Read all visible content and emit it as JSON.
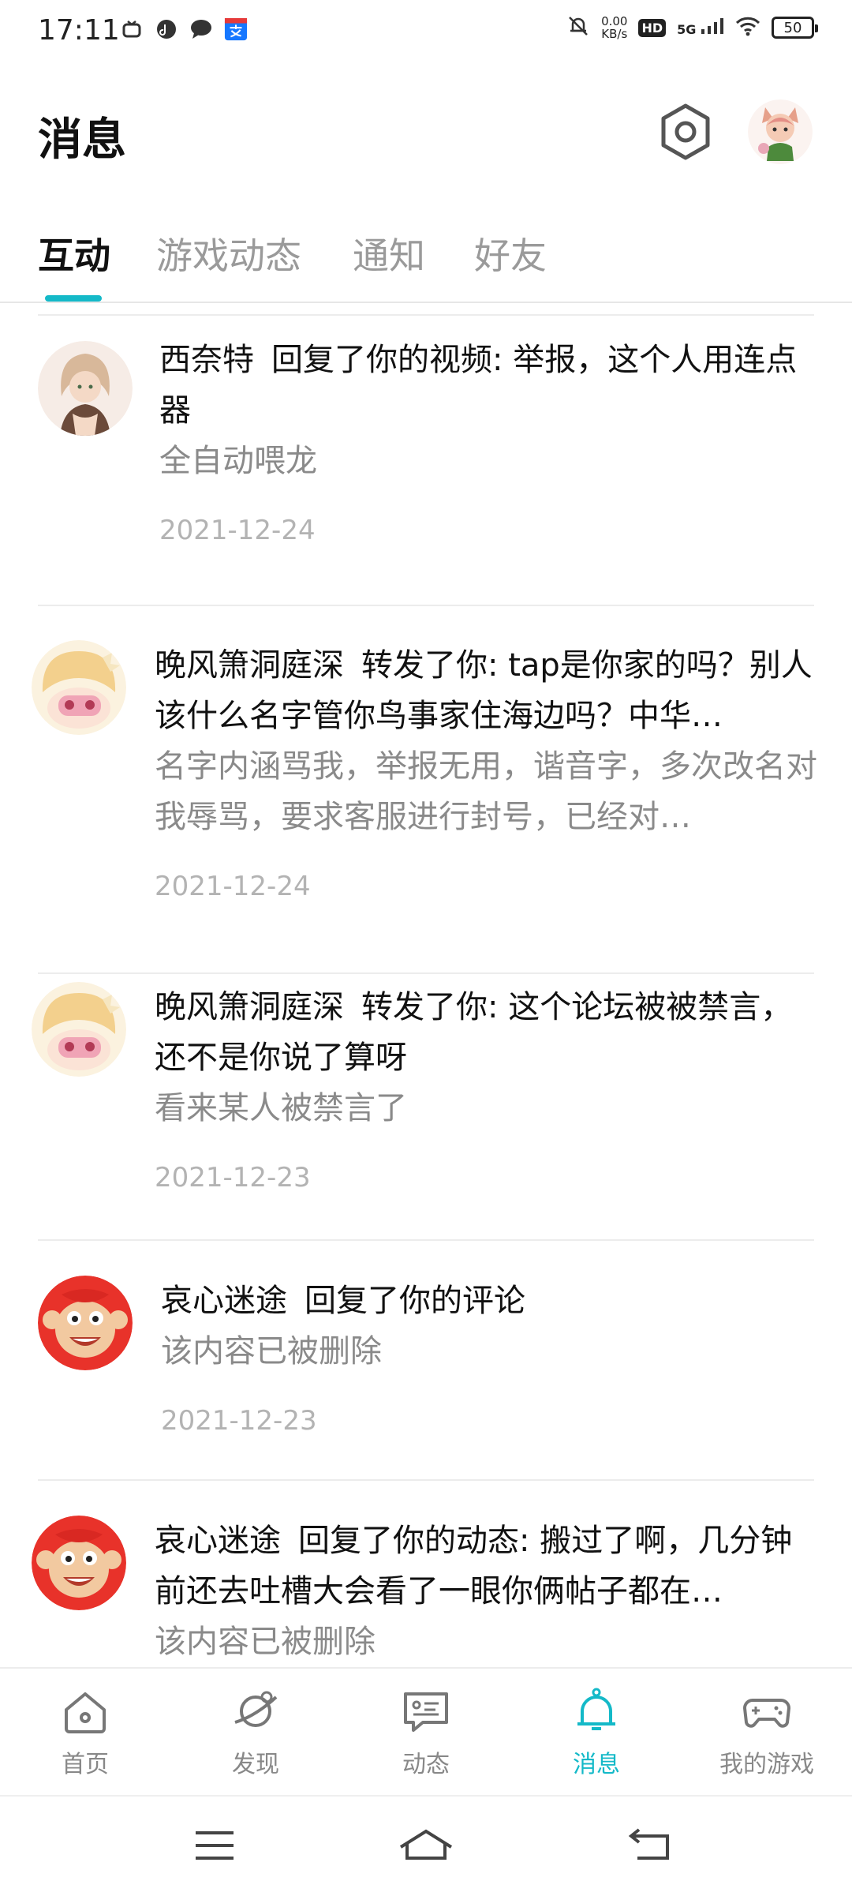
{
  "status_bar": {
    "time": "17:11",
    "net_speed_value": "0.00",
    "net_speed_unit": "KB/s",
    "hd": "HD",
    "network": "5G",
    "battery": "50"
  },
  "header": {
    "title": "消息",
    "settings_icon": "hexagon-settings-icon"
  },
  "tabs": [
    "互动",
    "游戏动态",
    "通知",
    "好友"
  ],
  "active_tab": 0,
  "messages": [
    {
      "nick": "西奈特",
      "action": "回复了你的视频: 举报，这个人用连点器",
      "sub": "全自动喂龙",
      "date": "2021-12-24"
    },
    {
      "nick": "晚风箫洞庭深",
      "action": "转发了你: tap是你家的吗？别人该什么名字管你鸟事家住海边吗？中华…",
      "sub": "名字内涵骂我，举报无用，谐音字，多次改名对我辱骂，要求客服进行封号，已经对…",
      "date": "2021-12-24"
    },
    {
      "nick": "晚风箫洞庭深",
      "action": "转发了你: 这个论坛被被禁言，还不是你说了算呀",
      "sub": "看来某人被禁言了",
      "date": "2021-12-23"
    },
    {
      "nick": "哀心迷途",
      "action": "回复了你的评论",
      "sub": "该内容已被删除",
      "date": "2021-12-23"
    },
    {
      "nick": "哀心迷途",
      "action": "回复了你的动态: 搬过了啊，几分钟前还去吐槽大会看了一眼你俩帖子都在…",
      "sub": "该内容已被删除",
      "date": ""
    }
  ],
  "bottom_nav": [
    {
      "label": "首页",
      "icon": "home-icon"
    },
    {
      "label": "发现",
      "icon": "planet-icon"
    },
    {
      "label": "动态",
      "icon": "chat-card-icon"
    },
    {
      "label": "消息",
      "icon": "bell-icon"
    },
    {
      "label": "我的游戏",
      "icon": "gamepad-icon"
    }
  ],
  "active_nav": 3,
  "colors": {
    "accent": "#14b9c8",
    "text": "#111111",
    "secondary": "#8a8a8a",
    "date": "#b3b3b3"
  }
}
